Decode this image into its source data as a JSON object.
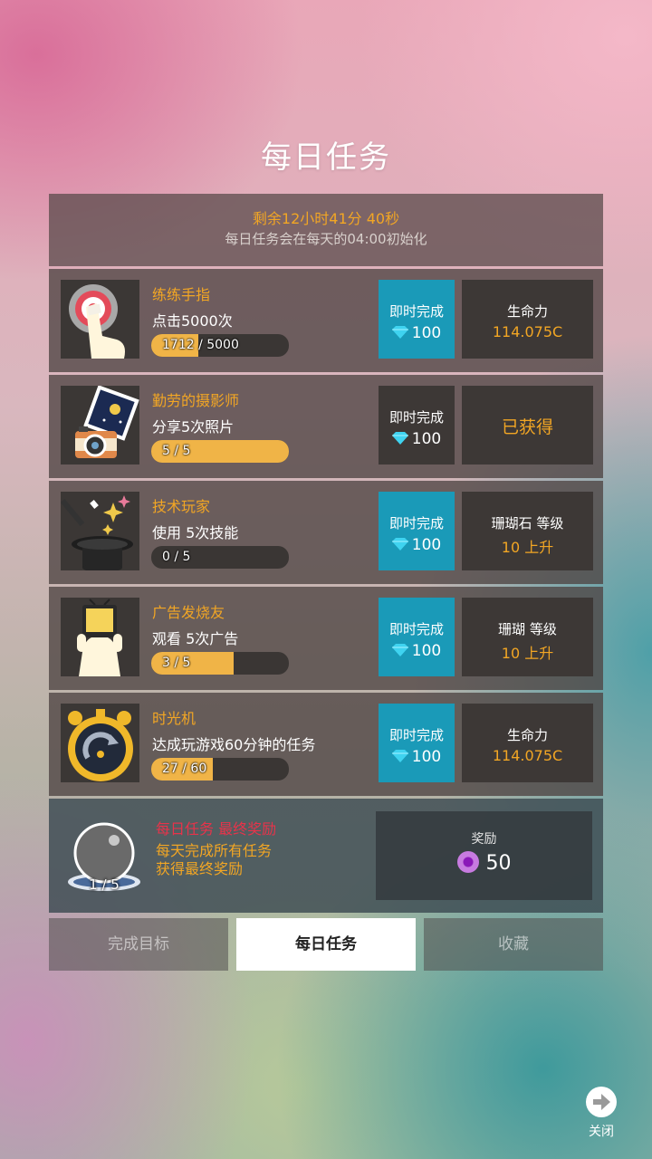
{
  "page": {
    "title": "每日任务"
  },
  "timer": {
    "remaining": "剩余12小时41分 40秒",
    "reset_note": "每日任务会在每天的04:00初始化"
  },
  "tasks": [
    {
      "title": "练练手指",
      "desc": "点击5000次",
      "progress_text": "1712 / 5000",
      "progress": 0.342,
      "instant_label": "即时完成",
      "instant_cost": "100",
      "instant_active": true,
      "reward_name": "生命力",
      "reward_value": "114.075C",
      "thumb_icon": "finger-target-icon"
    },
    {
      "title": "勤劳的摄影师",
      "desc": "分享5次照片",
      "progress_text": "5 / 5",
      "progress": 1.0,
      "instant_label": "即时完成",
      "instant_cost": "100",
      "instant_active": false,
      "reward_status": "已获得",
      "thumb_icon": "camera-photo-icon"
    },
    {
      "title": "技术玩家",
      "desc": "使用 5次技能",
      "progress_text": "0 / 5",
      "progress": 0.0,
      "instant_label": "即时完成",
      "instant_cost": "100",
      "instant_active": true,
      "reward_name": "珊瑚石 等级",
      "reward_value": "10 上升",
      "thumb_icon": "magic-hat-icon"
    },
    {
      "title": "广告发烧友",
      "desc": "观看 5次广告",
      "progress_text": "3 / 5",
      "progress": 0.6,
      "instant_label": "即时完成",
      "instant_cost": "100",
      "instant_active": true,
      "reward_name": "珊瑚 等级",
      "reward_value": "10 上升",
      "thumb_icon": "tv-icon"
    },
    {
      "title": "时光机",
      "desc": "达成玩游戏60分钟的任务",
      "progress_text": "27 / 60",
      "progress": 0.45,
      "instant_label": "即时完成",
      "instant_cost": "100",
      "instant_active": true,
      "reward_name": "生命力",
      "reward_value": "114.075C",
      "thumb_icon": "stopwatch-icon"
    }
  ],
  "final_reward": {
    "title": "每日任务 最终奖励",
    "desc_line1": "每天完成所有任务",
    "desc_line2": "获得最终奖励",
    "progress_text": "1 / 5",
    "reward_label": "奖励",
    "reward_value": "50"
  },
  "tabs": [
    {
      "label": "完成目标",
      "active": false
    },
    {
      "label": "每日任务",
      "active": true
    },
    {
      "label": "收藏",
      "active": false
    }
  ],
  "close": {
    "label": "关闭"
  },
  "colors": {
    "accent_orange": "#f2a624",
    "instant_blue": "#1a9ab8",
    "alert_red": "#e8334a",
    "gem_cyan": "#3fd3f0"
  }
}
